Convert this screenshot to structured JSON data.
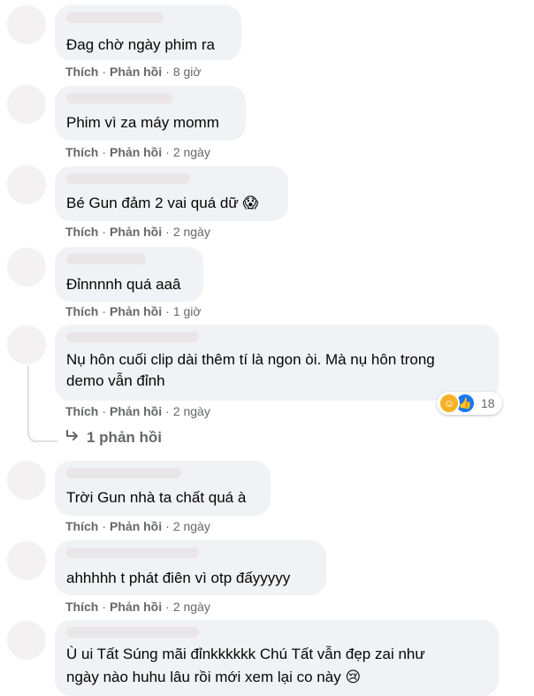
{
  "actions": {
    "like": "Thích",
    "reply": "Phản hồi",
    "sep": "·"
  },
  "comments": [
    {
      "text": "Đag chờ ngày phim ra",
      "time": "8 giờ"
    },
    {
      "text": "Phim vì za máy momm",
      "time": "2 ngày"
    },
    {
      "text": "Bé Gun đảm 2 vai quá dữ",
      "emoji": "😱",
      "time": "2 ngày"
    },
    {
      "text": "Đỉnnnnh quá aaâ",
      "time": "1 giờ"
    },
    {
      "lines": [
        "Nụ hôn cuối clip dài thêm tí là ngon òi. Mà nụ hôn trong",
        "demo vẫn đỉnh"
      ],
      "time": "2 ngày",
      "reaction_count": "18",
      "replies_label": "1 phản hồi"
    },
    {
      "text": "Trời Gun nhà ta chất quá à",
      "time": "2 ngày"
    },
    {
      "text": "ahhhhh t phát điên vì otp đấyyyyy",
      "time": "2 ngày"
    },
    {
      "lines": [
        "Ù ui Tất Súng mãi đỉnkkkkkk Chú Tất vẫn đẹp zai như",
        "ngày nào huhu lâu rồi mới xem lại co này"
      ],
      "emoji": "😢"
    }
  ],
  "icons": {
    "reply_arrow": "reply-arrow-icon",
    "haha": "haha-reaction-icon",
    "like": "like-reaction-icon"
  },
  "colors": {
    "bubble": "#f0f2f5",
    "meta": "#65676b",
    "like_blue": "#1877f2",
    "haha_yellow": "#f7b125"
  }
}
